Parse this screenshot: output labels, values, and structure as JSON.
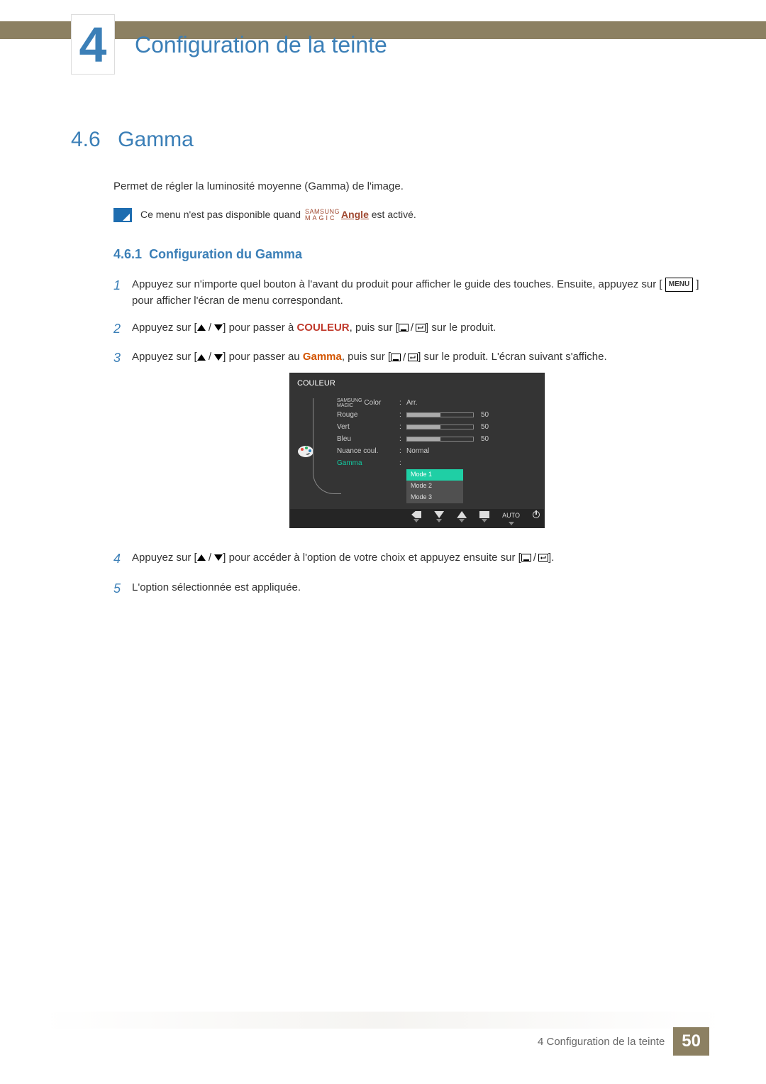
{
  "chapter": {
    "number": "4",
    "title": "Configuration de la teinte"
  },
  "section": {
    "number": "4.6",
    "title": "Gamma"
  },
  "intro": "Permet de régler la luminosité moyenne (Gamma) de l'image.",
  "note": {
    "pre": "Ce menu n'est pas disponible quand ",
    "magic_top": "SAMSUNG",
    "magic_bot": "MAGIC",
    "magic_word": "Angle",
    "post": " est activé."
  },
  "subsection": {
    "number": "4.6.1",
    "title": "Configuration du Gamma"
  },
  "steps": {
    "s1": {
      "n": "1",
      "a": "Appuyez sur n'importe quel bouton à l'avant du produit pour afficher le guide des touches. Ensuite, appuyez sur [",
      "menu": "MENU",
      "b": "] pour afficher l'écran de menu correspondant."
    },
    "s2": {
      "n": "2",
      "a": "Appuyez sur [",
      "b": "] pour passer à ",
      "kw": "COULEUR",
      "c": ", puis sur [",
      "d": "] sur le produit."
    },
    "s3": {
      "n": "3",
      "a": "Appuyez sur [",
      "b": "] pour passer au ",
      "kw": "Gamma",
      "c": ", puis sur [",
      "d": "] sur le produit. L'écran suivant s'affiche."
    },
    "s4": {
      "n": "4",
      "a": "Appuyez sur [",
      "b": "] pour accéder à l'option de votre choix et appuyez ensuite sur [",
      "c": "]."
    },
    "s5": {
      "n": "5",
      "a": "L'option sélectionnée est appliquée."
    }
  },
  "osd": {
    "title": "COULEUR",
    "magic_top": "SAMSUNG",
    "magic_bot": "MAGIC",
    "magic_color": "Color",
    "magic_val": "Arr.",
    "rouge": "Rouge",
    "rouge_v": "50",
    "vert": "Vert",
    "vert_v": "50",
    "bleu": "Bleu",
    "bleu_v": "50",
    "nuance": "Nuance coul.",
    "nuance_v": "Normal",
    "gamma": "Gamma",
    "mode1": "Mode 1",
    "mode2": "Mode 2",
    "mode3": "Mode 3",
    "auto": "AUTO"
  },
  "footer": {
    "text": "4 Configuration de la teinte",
    "page": "50"
  }
}
